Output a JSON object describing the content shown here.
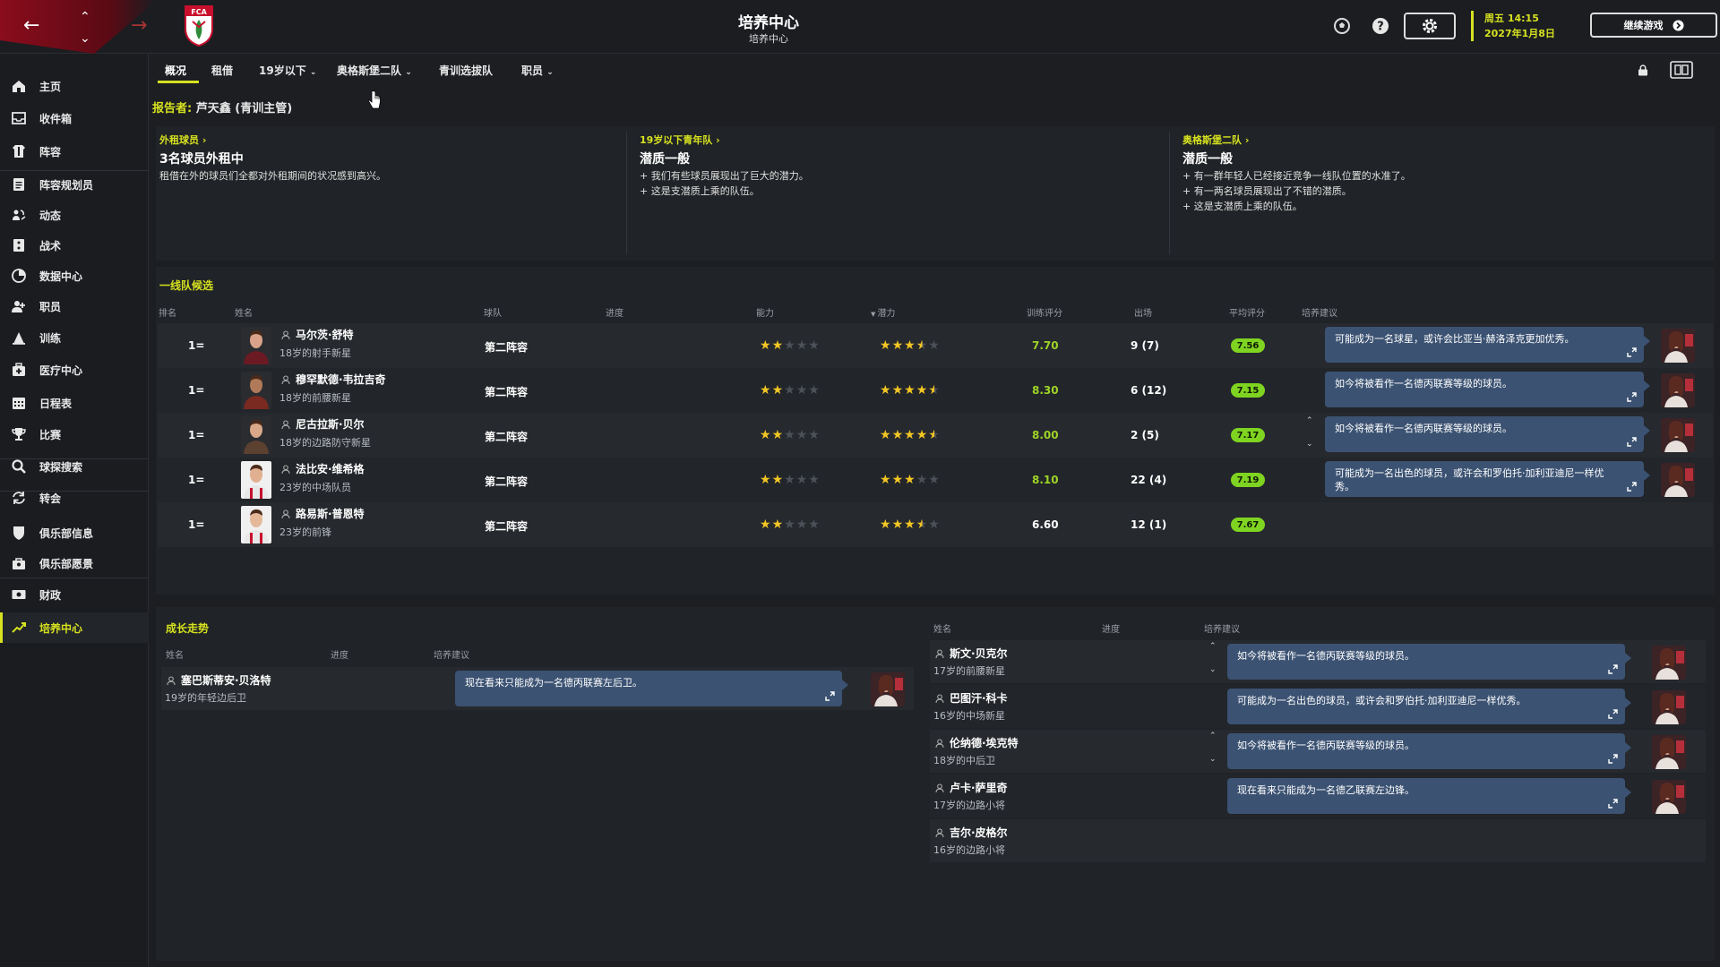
{
  "header": {
    "title": "培养中心",
    "subtitle": "培养中心",
    "club_badge_text": "FCA",
    "date_line1": "周五 14:15",
    "date_line2": "2027年1月8日",
    "continue_label": "继续游戏",
    "accent_color": "#d6e21f"
  },
  "sidebar": {
    "items": [
      {
        "label": "主页",
        "icon": "home-icon"
      },
      {
        "label": "收件箱",
        "icon": "inbox-icon"
      },
      {
        "label": "阵容",
        "icon": "shirt-icon"
      },
      {
        "label": "阵容规划员",
        "icon": "clipboard-icon"
      },
      {
        "label": "动态",
        "icon": "dynamics-icon"
      },
      {
        "label": "战术",
        "icon": "tactics-icon"
      },
      {
        "label": "数据中心",
        "icon": "data-icon"
      },
      {
        "label": "职员",
        "icon": "staff-icon"
      },
      {
        "label": "训练",
        "icon": "training-icon"
      },
      {
        "label": "医疗中心",
        "icon": "medical-icon"
      },
      {
        "label": "日程表",
        "icon": "calendar-icon"
      },
      {
        "label": "比赛",
        "icon": "trophy-icon"
      },
      {
        "label": "球探搜索",
        "icon": "search-icon"
      },
      {
        "label": "转会",
        "icon": "transfer-icon"
      },
      {
        "label": "俱乐部信息",
        "icon": "shield-icon"
      },
      {
        "label": "俱乐部愿景",
        "icon": "vision-icon"
      },
      {
        "label": "财政",
        "icon": "finance-icon"
      },
      {
        "label": "培养中心",
        "icon": "development-icon"
      }
    ]
  },
  "tabs": [
    "概况",
    "租借",
    "19岁以下",
    "奥格斯堡二队",
    "青训选拔队",
    "职员"
  ],
  "reporter": {
    "label": "报告者:",
    "name": "芦天鑫 (青训主管)"
  },
  "overview": [
    {
      "link": "外租球员",
      "title": "3名球员外租中",
      "bullets": [
        "租借在外的球员们全都对外租期间的状况感到高兴。"
      ]
    },
    {
      "link": "19岁以下青年队",
      "title": "潜质一般",
      "bullets": [
        "+ 我们有些球员展现出了巨大的潜力。",
        "+ 这是支潜质上乘的队伍。"
      ]
    },
    {
      "link": "奥格斯堡二队",
      "title": "潜质一般",
      "bullets": [
        "+ 有一群年轻人已经接近竞争一线队位置的水准了。",
        "+ 有一两名球员展现出了不错的潜质。",
        "+ 这是支潜质上乘的队伍。"
      ]
    }
  ],
  "first_team": {
    "title": "一线队候选",
    "columns": [
      "排名",
      "姓名",
      "球队",
      "进度",
      "能力",
      "潜力",
      "训练评分",
      "出场",
      "平均评分",
      "培养建议"
    ],
    "rows": [
      {
        "rank": "1=",
        "name": "马尔茨·舒特",
        "desc": "18岁的射手新星",
        "team": "第二阵容",
        "ability": 2,
        "potential": 3.5,
        "training": "7.70",
        "apps": "9 (7)",
        "avg": "7.56",
        "advice": "可能成为一名球星，或许会比亚当·赫洛泽克更加优秀。"
      },
      {
        "rank": "1=",
        "name": "穆罕默德·韦拉吉奇",
        "desc": "18岁的前腰新星",
        "team": "第二阵容",
        "ability": 2,
        "potential": 4.5,
        "training": "8.30",
        "apps": "6 (12)",
        "avg": "7.15",
        "advice": "如今将被看作一名德丙联赛等级的球员。"
      },
      {
        "rank": "1=",
        "name": "尼古拉斯·贝尔",
        "desc": "18岁的边路防守新星",
        "team": "第二阵容",
        "ability": 2,
        "potential": 4.5,
        "training": "8.00",
        "apps": "2 (5)",
        "avg": "7.17",
        "advice": "如今将被看作一名德丙联赛等级的球员。"
      },
      {
        "rank": "1=",
        "name": "法比安·维希格",
        "desc": "23岁的中场队员",
        "team": "第二阵容",
        "ability": 2,
        "potential": 3,
        "training": "8.10",
        "apps": "22 (4)",
        "avg": "7.19",
        "advice": "可能成为一名出色的球员，或许会和罗伯托·加利亚迪尼一样优秀。"
      },
      {
        "rank": "1=",
        "name": "路易斯·普恩特",
        "desc": "23岁的前锋",
        "team": "第二阵容",
        "ability": 2,
        "potential": 3.5,
        "training": "6.60",
        "apps": "12 (1)",
        "avg": "7.67",
        "advice": ""
      }
    ]
  },
  "growth": {
    "title": "成长走势",
    "columns": [
      "姓名",
      "进度",
      "培养建议"
    ],
    "left_rows": [
      {
        "name": "塞巴斯蒂安·贝洛特",
        "desc": "19岁的年轻边后卫",
        "advice": "现在看来只能成为一名德丙联赛左后卫。"
      }
    ],
    "right_rows": [
      {
        "name": "斯文·贝克尔",
        "desc": "17岁的前腰新星",
        "advice": "如今将被看作一名德丙联赛等级的球员。"
      },
      {
        "name": "巴图汗·科卡",
        "desc": "16岁的中场新星",
        "advice": "可能成为一名出色的球员，或许会和罗伯托·加利亚迪尼一样优秀。"
      },
      {
        "name": "伦纳德·埃克特",
        "desc": "18岁的中后卫",
        "advice": "如今将被看作一名德丙联赛等级的球员。"
      },
      {
        "name": "卢卡·萨里奇",
        "desc": "17岁的边路小将",
        "advice": "现在看来只能成为一名德乙联赛左边锋。"
      },
      {
        "name": "吉尔·皮格尔",
        "desc": "16岁的边路小将",
        "advice": ""
      }
    ]
  }
}
